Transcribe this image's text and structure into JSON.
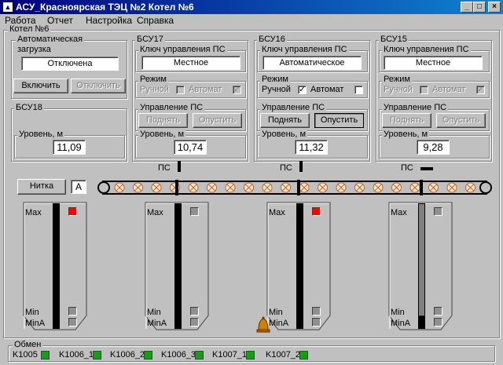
{
  "window": {
    "title": "АСУ_Красноярская ТЭЦ №2   Котел №6",
    "minimize": "_",
    "maximize": "□",
    "close": "×"
  },
  "menu": [
    "Работа",
    "Отчет",
    "Настройка",
    "Справка"
  ],
  "main_group": "Котел №6",
  "auto": {
    "title": "Автоматическая загрузка",
    "title_line1": "Автоматическая",
    "title_line2": "загрузка",
    "status": "Отключена",
    "enable_label": "Включить",
    "disable_label": "Отключить"
  },
  "bsu18": {
    "title": "БСУ18",
    "level_label": "Уровень, м",
    "level": "11,09"
  },
  "panels": [
    {
      "title": "БСУ17",
      "key_label": "Ключ управления ПС",
      "key_value": "Местное",
      "mode_label": "Режим",
      "manual_label": "Ручной",
      "auto_label": "Автомат",
      "control_label": "Управление ПС",
      "raise_label": "Поднять",
      "lower_label": "Опустить",
      "level_label": "Уровень, м",
      "level": "10,74"
    },
    {
      "title": "БСУ16",
      "key_label": "Ключ управления ПС",
      "key_value": "Автоматическое",
      "mode_label": "Режим",
      "manual_label": "Ручной",
      "auto_label": "Автомат",
      "control_label": "Управление ПС",
      "raise_label": "Поднять",
      "lower_label": "Опустить",
      "level_label": "Уровень, м",
      "level": "11,32"
    },
    {
      "title": "БСУ15",
      "key_label": "Ключ управления ПС",
      "key_value": "Местное",
      "mode_label": "Режим",
      "manual_label": "Ручной",
      "auto_label": "Автомат",
      "control_label": "Управление ПС",
      "raise_label": "Поднять",
      "lower_label": "Опустить",
      "level_label": "Уровень, м",
      "level": "9,28"
    }
  ],
  "plows": [
    {
      "label": "ПС",
      "state": "vertical"
    },
    {
      "label": "ПС",
      "state": "vertical"
    },
    {
      "label": "ПС",
      "state": "horizontal"
    }
  ],
  "conveyor": {
    "thread_button": "Нитка",
    "thread_value": "A"
  },
  "tanks": [
    {
      "max_label": "Max",
      "min_label": "Min",
      "mina_label": "MinA",
      "max_state": "red",
      "fill": 0
    },
    {
      "max_label": "Max",
      "min_label": "Min",
      "mina_label": "MinA",
      "max_state": "gray",
      "fill": 0
    },
    {
      "max_label": "Max",
      "min_label": "Min",
      "mina_label": "MinA",
      "max_state": "red",
      "fill": 0
    },
    {
      "max_label": "Max",
      "min_label": "Min",
      "mina_label": "MinA",
      "max_state": "gray",
      "fill": 0.1
    }
  ],
  "exchange": {
    "title": "Обмен",
    "items": [
      {
        "label": "K1005",
        "state": "green"
      },
      {
        "label": "K1006_1",
        "state": "green"
      },
      {
        "label": "K1006_2",
        "state": "green"
      },
      {
        "label": "K1006_3",
        "state": "green"
      },
      {
        "label": "K1007_1",
        "state": "green"
      },
      {
        "label": "K1007_2",
        "state": "green"
      }
    ]
  },
  "colors": {
    "title_bar": "#000080",
    "alarm": "#ff0000",
    "ok": "#10a010",
    "bell": "#d08000"
  }
}
